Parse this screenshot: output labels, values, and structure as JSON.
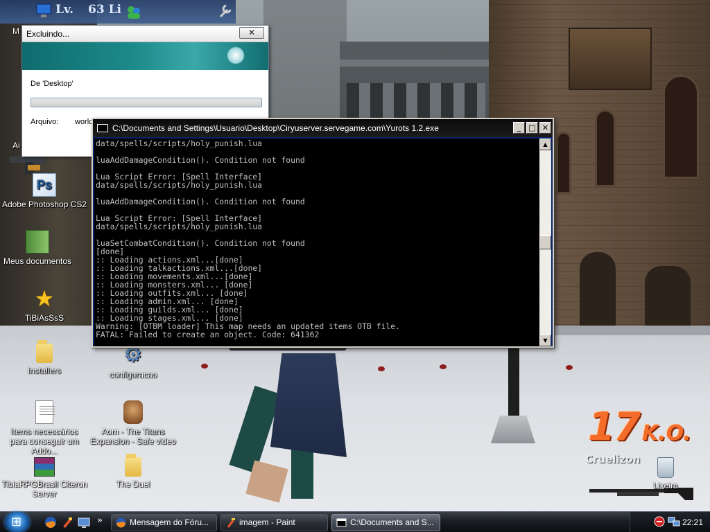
{
  "hud": {
    "level_label": "Lv.",
    "level_value": "63 Li"
  },
  "desktop_icons": [
    {
      "label": "Adobe Photoshop CS2"
    },
    {
      "label": "Meus documentos"
    },
    {
      "label": "TiBiAsSsS"
    },
    {
      "label": "Installers"
    },
    {
      "label": "configuracao"
    },
    {
      "label": "Items necessários para conseguir um Addo..."
    },
    {
      "label": "Aom - The Titans Expansion - Safe video"
    },
    {
      "label": "TibiaRPGBrasil Citeron Server"
    },
    {
      "label": "The Duel"
    },
    {
      "label": "Lixeira"
    }
  ],
  "partial_icon_labels": {
    "top": "M",
    "mid": "Ai"
  },
  "delete_dialog": {
    "title": "Excluindo...",
    "close_glyph": "✕",
    "from_text": "De 'Desktop'",
    "progress_fraction": 0.0,
    "file_label": "Arquivo:",
    "file_value": "worlc"
  },
  "console": {
    "title": "C:\\Documents and Settings\\Usuario\\Desktop\\Ciryuserver.servegame.com\\Yurots 1.2.exe",
    "lines": [
      "data/spells/scripts/holy_punish.lua",
      "",
      "luaAddDamageCondition(). Condition not found",
      "",
      "Lua Script Error: [Spell Interface]",
      "data/spells/scripts/holy_punish.lua",
      "",
      "luaAddDamageCondition(). Condition not found",
      "",
      "Lua Script Error: [Spell Interface]",
      "data/spells/scripts/holy_punish.lua",
      "",
      "luaSetCombatCondition(). Condition not found",
      "[done]",
      ":: Loading actions.xml...[done]",
      ":: Loading talkactions.xml...[done]",
      ":: Loading movements.xml...[done]",
      ":: Loading monsters.xml... [done]",
      ":: Loading outfits.xml... [done]",
      ":: Loading admin.xml... [done]",
      ":: Loading guilds.xml... [done]",
      ":: Loading stages.xml... [done]",
      "Warning: [OTBM loader] This map needs an updated items OTB file.",
      "FATAL: Failed to create an object. Code: 641362"
    ]
  },
  "game_overlay": {
    "ko_number": "17",
    "ko_text": "K.O.",
    "player_name": "Cruelizon"
  },
  "taskbar": {
    "tasks": [
      {
        "label": "Mensagem do Fóru...",
        "icon": "firefox-icon"
      },
      {
        "label": "imagem - Paint",
        "icon": "paint-icon"
      },
      {
        "label": "C:\\Documents and S...",
        "icon": "console-icon",
        "active": true
      }
    ],
    "overflow_glyph": "»",
    "clock": "22:21"
  }
}
